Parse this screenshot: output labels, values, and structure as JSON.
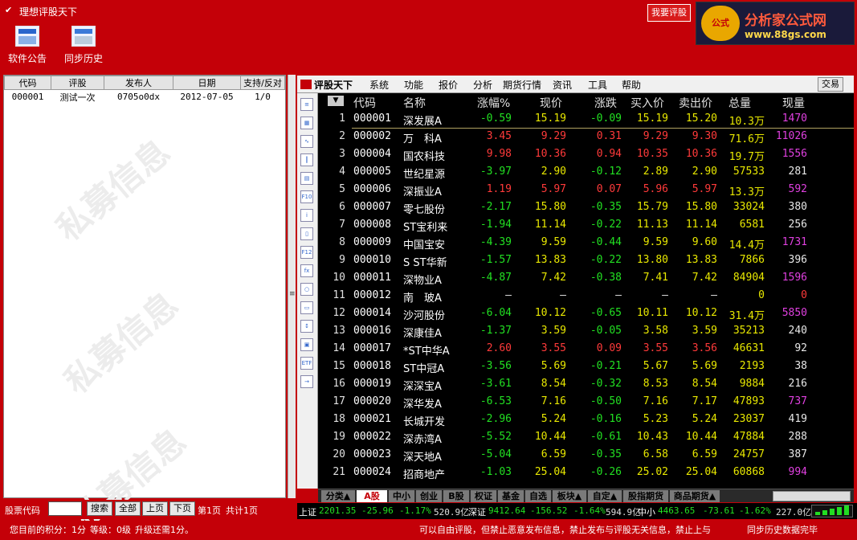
{
  "window": {
    "title": "理想评股天下",
    "rate_button": "我要评股"
  },
  "logo": {
    "line1": "分析家公式网",
    "line2": "www.88gs.com",
    "mark": "公式"
  },
  "toolbar": [
    {
      "label": "软件公告",
      "icon": "news-icon"
    },
    {
      "label": "同步历史",
      "icon": "sync-history-icon"
    }
  ],
  "left_table": {
    "columns": [
      "代码",
      "评股",
      "发布人",
      "日期",
      "支持/反对"
    ],
    "rows": [
      [
        "000001",
        "测试一次",
        "0705o0dx",
        "2012-07-05",
        "1/0"
      ]
    ],
    "watermark": "私募信息"
  },
  "left_bottom": {
    "label": "股票代码",
    "input_value": "",
    "search": "搜索",
    "all": "全部",
    "prev": "上页",
    "next": "下页",
    "page": "第1页",
    "total": "共计1页"
  },
  "status": {
    "points": "您目前的积分：1分",
    "level": "等级：0级",
    "upgrade": "升级还需1分。",
    "notice": "可以自由评股，但禁止恶意发布信息，禁止发布与评股无关信息，禁止上与",
    "sync": "同步历史数据完毕"
  },
  "menu": {
    "brand": "评股天下",
    "items": [
      "系统",
      "功能",
      "报价",
      "分析",
      "期货行情",
      "资讯",
      "工具",
      "帮助"
    ],
    "trade": "交易"
  },
  "side_icons": [
    "quote-icon",
    "table-icon",
    "chart-icon",
    "kline-icon",
    "report-icon",
    "f10-icon",
    "info-icon",
    "notebook-icon",
    "f12-icon",
    "formula-icon",
    "search-icon",
    "folder-icon",
    "up-down-icon",
    "grid-icon",
    "etf-icon",
    "exit-icon"
  ],
  "grid": {
    "headers": [
      "代码",
      "名称",
      "涨幅%",
      "现价",
      "涨跌",
      "买入价",
      "卖出价",
      "总量",
      "现量"
    ],
    "rows": [
      [
        "1",
        "000001",
        "深发展A",
        "-0.59",
        "15.19",
        "-0.09",
        "15.19",
        "15.20",
        "10.3万",
        "1470",
        "g",
        "m"
      ],
      [
        "2",
        "000002",
        "万　科A",
        "3.45",
        "9.29",
        "0.31",
        "9.29",
        "9.30",
        "71.6万",
        "11026",
        "r",
        "m"
      ],
      [
        "3",
        "000004",
        "国农科技",
        "9.98",
        "10.36",
        "0.94",
        "10.35",
        "10.36",
        "19.7万",
        "1556",
        "r",
        "m"
      ],
      [
        "4",
        "000005",
        "世纪星源",
        "-3.97",
        "2.90",
        "-0.12",
        "2.89",
        "2.90",
        "57533",
        "281",
        "g",
        "w"
      ],
      [
        "5",
        "000006",
        "深振业A",
        "1.19",
        "5.97",
        "0.07",
        "5.96",
        "5.97",
        "13.3万",
        "592",
        "r",
        "m"
      ],
      [
        "6",
        "000007",
        "零七股份",
        "-2.17",
        "15.80",
        "-0.35",
        "15.79",
        "15.80",
        "33024",
        "380",
        "g",
        "w"
      ],
      [
        "7",
        "000008",
        "ST宝利来",
        "-1.94",
        "11.14",
        "-0.22",
        "11.13",
        "11.14",
        "6581",
        "256",
        "g",
        "w"
      ],
      [
        "8",
        "000009",
        "中国宝安",
        "-4.39",
        "9.59",
        "-0.44",
        "9.59",
        "9.60",
        "14.4万",
        "1731",
        "g",
        "m"
      ],
      [
        "9",
        "000010",
        "S ST华新",
        "-1.57",
        "13.83",
        "-0.22",
        "13.80",
        "13.83",
        "7866",
        "396",
        "g",
        "w"
      ],
      [
        "10",
        "000011",
        "深物业A",
        "-4.87",
        "7.42",
        "-0.38",
        "7.41",
        "7.42",
        "84904",
        "1596",
        "g",
        "m"
      ],
      [
        "11",
        "000012",
        "南　玻A",
        "—",
        "—",
        "—",
        "—",
        "—",
        "0",
        "0",
        "w",
        "r"
      ],
      [
        "12",
        "000014",
        "沙河股份",
        "-6.04",
        "10.12",
        "-0.65",
        "10.11",
        "10.12",
        "31.4万",
        "5850",
        "g",
        "m"
      ],
      [
        "13",
        "000016",
        "深康佳A",
        "-1.37",
        "3.59",
        "-0.05",
        "3.58",
        "3.59",
        "35213",
        "240",
        "g",
        "w"
      ],
      [
        "14",
        "000017",
        "*ST中华A",
        "2.60",
        "3.55",
        "0.09",
        "3.55",
        "3.56",
        "46631",
        "92",
        "r",
        "w"
      ],
      [
        "15",
        "000018",
        "ST中冠A",
        "-3.56",
        "5.69",
        "-0.21",
        "5.67",
        "5.69",
        "2193",
        "38",
        "g",
        "w"
      ],
      [
        "16",
        "000019",
        "深深宝A",
        "-3.61",
        "8.54",
        "-0.32",
        "8.53",
        "8.54",
        "9884",
        "216",
        "g",
        "w"
      ],
      [
        "17",
        "000020",
        "深华发A",
        "-6.53",
        "7.16",
        "-0.50",
        "7.16",
        "7.17",
        "47893",
        "737",
        "g",
        "m"
      ],
      [
        "18",
        "000021",
        "长城开发",
        "-2.96",
        "5.24",
        "-0.16",
        "5.23",
        "5.24",
        "23037",
        "419",
        "g",
        "w"
      ],
      [
        "19",
        "000022",
        "深赤湾A",
        "-5.52",
        "10.44",
        "-0.61",
        "10.43",
        "10.44",
        "47884",
        "288",
        "g",
        "w"
      ],
      [
        "20",
        "000023",
        "深天地A",
        "-5.04",
        "6.59",
        "-0.35",
        "6.58",
        "6.59",
        "24757",
        "387",
        "g",
        "w"
      ],
      [
        "21",
        "000024",
        "招商地产",
        "-1.03",
        "25.04",
        "-0.26",
        "25.02",
        "25.04",
        "60868",
        "994",
        "g",
        "m"
      ]
    ]
  },
  "bottom_tabs": [
    "分类▲",
    "A股",
    "中小",
    "创业",
    "B股",
    "权证",
    "基金",
    "自选",
    "板块▲",
    "自定▲",
    "股指期货",
    "商品期货▲"
  ],
  "ticker": {
    "sh_label": "上证",
    "sh": "2201.35",
    "sh_chg": "-25.96",
    "sh_pct": "-1.17%",
    "sh_amt": "520.9亿",
    "sz_label": "深证",
    "sz": "9412.64",
    "sz_chg": "-156.52",
    "sz_pct": "-1.64%",
    "sz_amt": "594.9亿",
    "zx_label": "中小",
    "zx": "4463.65",
    "zx_chg": "-73.61",
    "zx_pct": "-1.62%",
    "zx_amt": "227.0亿"
  },
  "colors": {
    "green": "#22e022",
    "red": "#ff3a3a",
    "yellow": "#e8e800",
    "magenta": "#e040e0",
    "white": "#e8e8e8",
    "accent": "#c40008"
  }
}
